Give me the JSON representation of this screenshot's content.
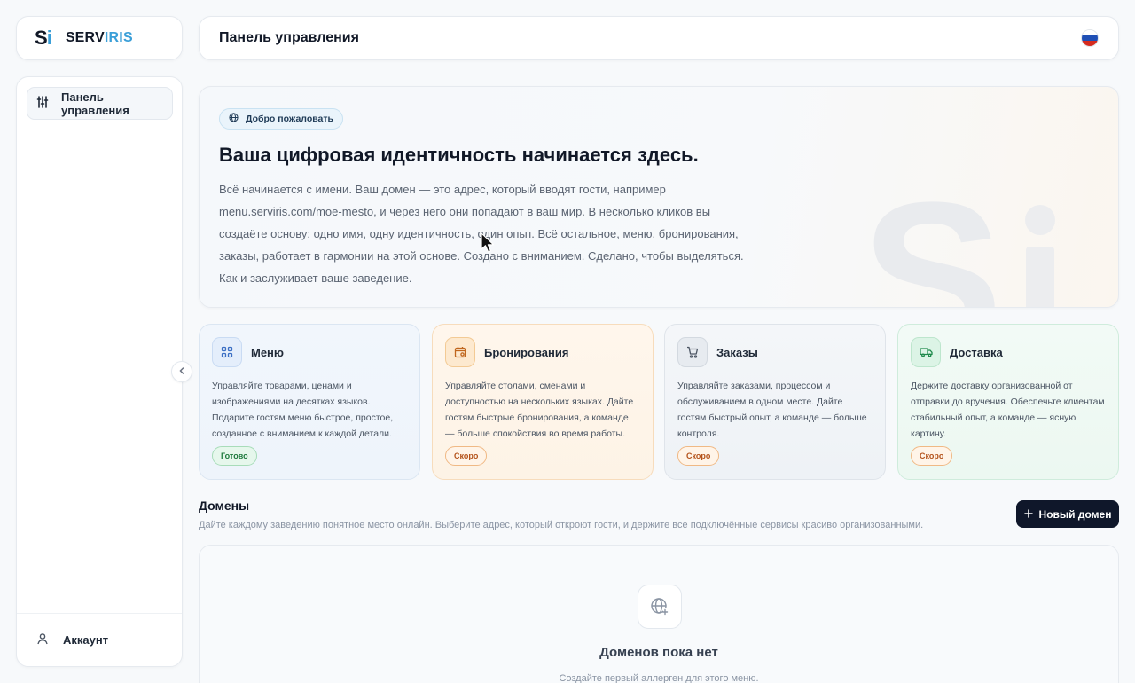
{
  "brand": {
    "mark_main": "S",
    "mark_accent": "i",
    "name_part1": "SERV",
    "name_part2": "IRIS"
  },
  "sidebar": {
    "items": [
      {
        "label": "Панель управления",
        "icon": "sliders-icon"
      }
    ],
    "account_label": "Аккаунт"
  },
  "header": {
    "title": "Панель управления",
    "language": "ru"
  },
  "hero": {
    "badge": "Добро пожаловать",
    "title": "Ваша цифровая идентичность начинается здесь.",
    "text": "Всё начинается с имени. Ваш домен — это адрес, который вводят гости, например menu.serviris.com/moe-mesto, и через него они попадают в ваш мир. В несколько кликов вы создаёте основу: одно имя, одну идентичность, один опыт. Всё остальное, меню, бронирования, заказы, работает в гармонии на этой основе. Создано с вниманием. Сделано, чтобы выделяться. Как и заслуживает ваше заведение."
  },
  "features": [
    {
      "title": "Меню",
      "desc": "Управляйте товарами, ценами и изображениями на десятках языков. Подарите гостям меню быстрое, простое, созданное с вниманием к каждой детали.",
      "tag": "Готово"
    },
    {
      "title": "Бронирования",
      "desc": "Управляйте столами, сменами и доступностью на нескольких языках. Дайте гостям быстрые бронирования, а команде — больше спокойствия во время работы.",
      "tag": "Скоро"
    },
    {
      "title": "Заказы",
      "desc": "Управляйте заказами, процессом и обслуживанием в одном месте. Дайте гостям быстрый опыт, а команде — больше контроля.",
      "tag": "Скоро"
    },
    {
      "title": "Доставка",
      "desc": "Держите доставку организованной от отправки до вручения. Обеспечьте клиентам стабильный опыт, а команде — ясную картину.",
      "tag": "Скоро"
    }
  ],
  "domains": {
    "title": "Домены",
    "subtitle": "Дайте каждому заведению понятное место онлайн. Выберите адрес, который откроют гости, и держите все подключённые сервисы красиво организованными.",
    "new_button": "Новый домен",
    "empty_title": "Доменов пока нет",
    "empty_sub": "Создайте первый аллерген для этого меню."
  },
  "colors": {
    "accent": "#3b9fd8",
    "dark_button": "#0f172a",
    "ready": "#1f7a3e",
    "soon": "#b4531c"
  }
}
